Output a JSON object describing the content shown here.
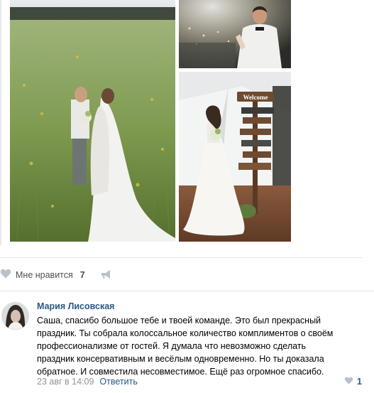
{
  "photos": [
    {
      "name": "wedding-couple-field-photo"
    },
    {
      "name": "groom-toast-photo"
    },
    {
      "name": "bride-welcome-sign-photo"
    }
  ],
  "sign": {
    "text": "Welcome"
  },
  "post_actions": {
    "like_label": "Мне нравится",
    "like_count": "7",
    "like_icon": "heart-icon",
    "share_icon": "megaphone-icon"
  },
  "comment": {
    "author": "Мария Лисовская",
    "text": "Саша, спасибо большое тебе и твоей команде. Это был прекрасный\nпраздник. Ты собрала колоссальное количество комплиментов о своём\nпрофессионализме от гостей. Я думала что невозможно сделать\nпраздник консервативным и весёлым одновременно. Но ты доказала\nобратное. И совместила несовместимое. Ещё раз огромное спасибо.",
    "date": "23 авг в 14:09",
    "reply_label": "Ответить",
    "like_count": "1"
  },
  "colors": {
    "link": "#2a5885",
    "muted": "#939393",
    "icon": "#b9c2cc",
    "divider": "#e7e8ec"
  }
}
